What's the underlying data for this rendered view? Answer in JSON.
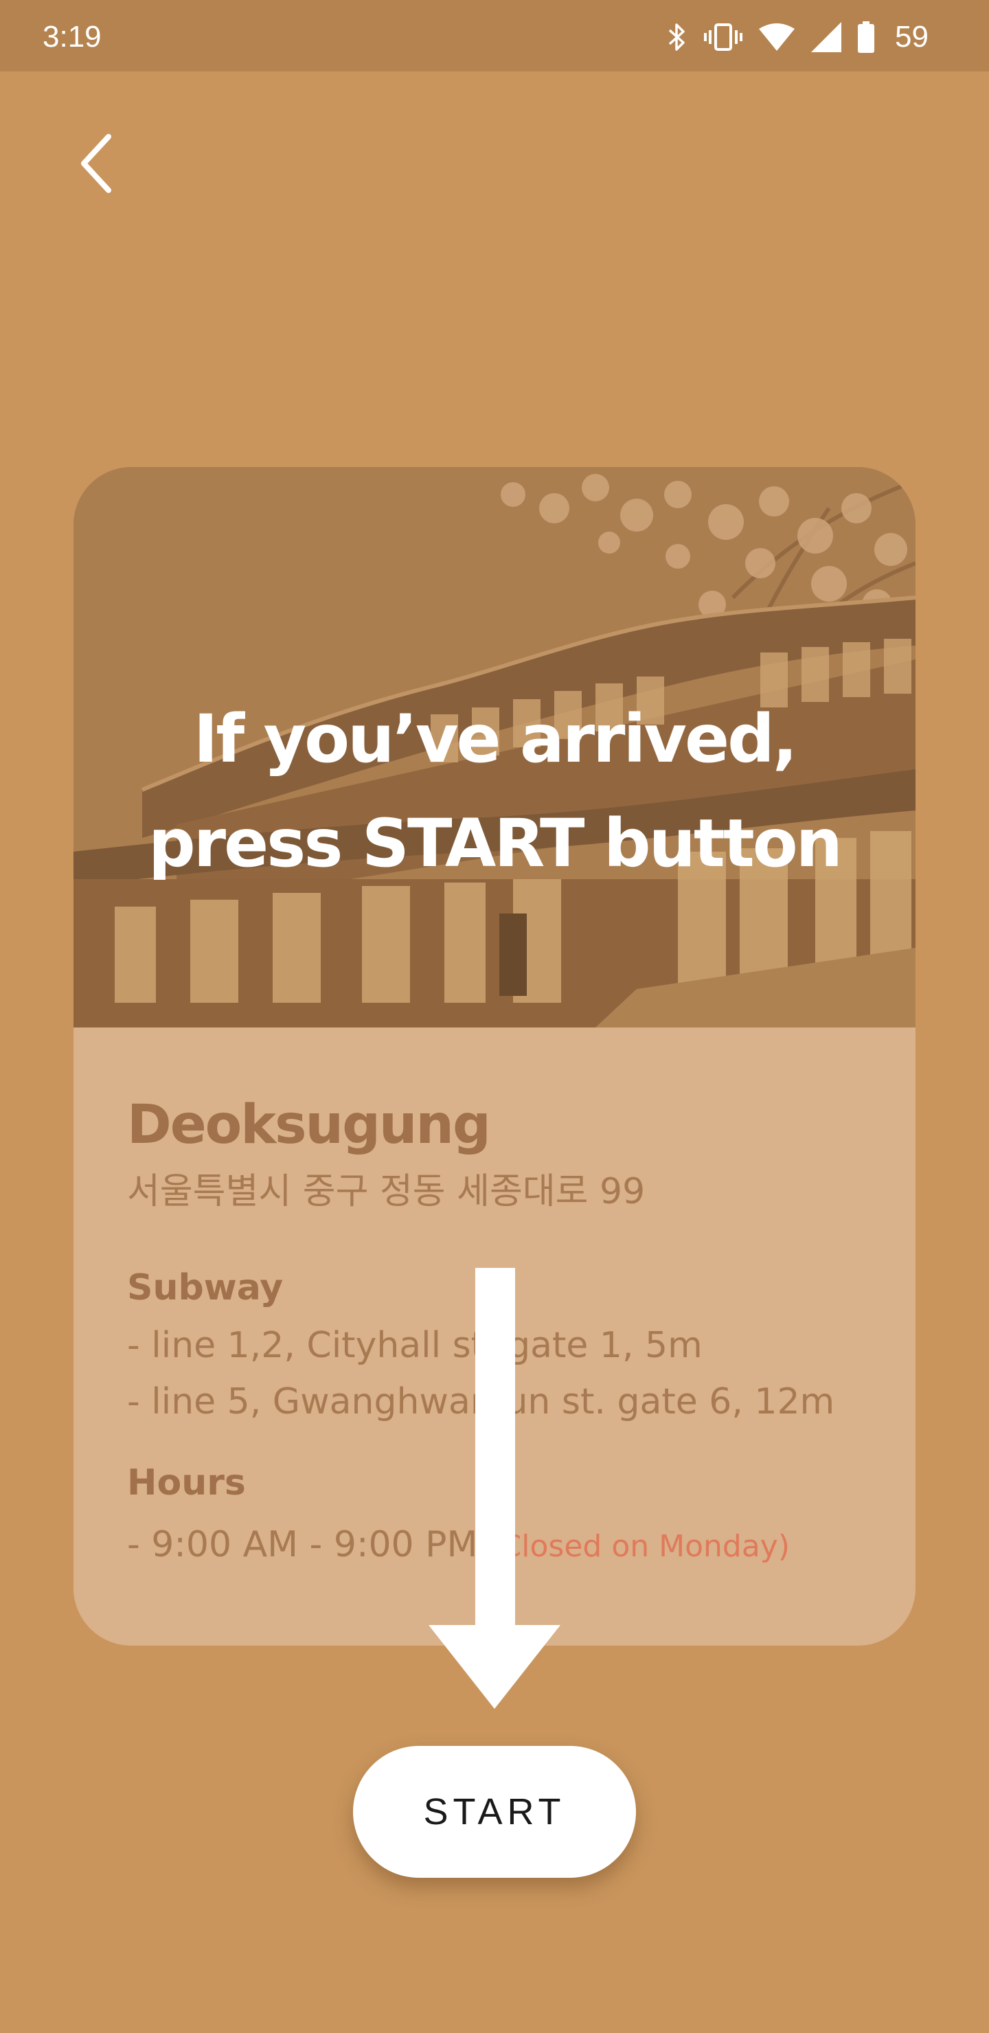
{
  "status_bar": {
    "time": "3:19",
    "battery_percent": "59",
    "icons": [
      "bluetooth-icon",
      "vibrate-icon",
      "wifi-icon",
      "cell-signal-icon",
      "battery-icon"
    ]
  },
  "navigation": {
    "back_icon": "chevron-left-icon"
  },
  "card": {
    "hero_title": "If you’ve arrived,\npress START button",
    "place_name": "Deoksugung",
    "address": "서울특별시 중구 정동 세종대로 99",
    "subway": {
      "label": "Subway",
      "lines": [
        "- line 1,2, Cityhall st. gate 1, 5m",
        "- line 5, Gwanghwamun st. gate 6, 12m"
      ]
    },
    "hours": {
      "label": "Hours",
      "time": "- 9:00 AM - 9:00 PM",
      "note": "(Closed on Monday)"
    }
  },
  "actions": {
    "start_label": "START"
  },
  "colors": {
    "background": "#c9955d",
    "status_bar": "#b5834f",
    "info_panel": "#d9b18a",
    "text_brown": "#a0714a",
    "closed_note": "#e07a5a",
    "button": "#ffffff"
  }
}
